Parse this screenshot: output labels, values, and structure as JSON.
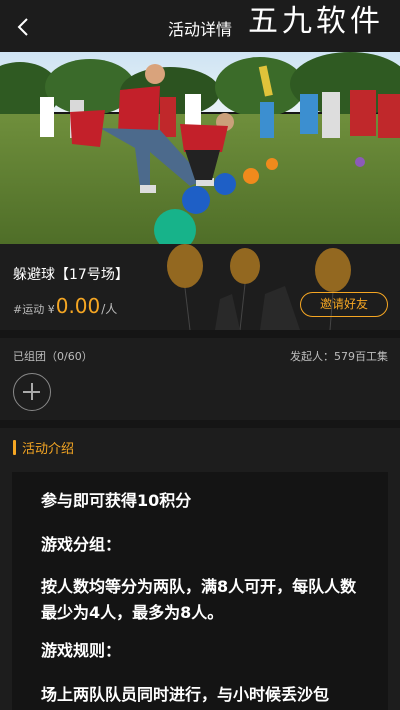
{
  "header": {
    "title": "活动详情",
    "watermark": "五九软件"
  },
  "event": {
    "name": "躲避球【17号场】",
    "price_tag": "#运动 ¥",
    "price": "0.00",
    "price_unit": "/人",
    "invite_label": "邀请好友"
  },
  "groups": {
    "label": "已组团（0/60）",
    "initiator_label": "发起人：",
    "initiator_name": "579百工集"
  },
  "intro": {
    "title": "活动介绍",
    "lines": [
      "参与即可获得10积分",
      "游戏分组：",
      "按人数均等分为两队，满8人可开，每队人数最少为4人，最多为8人。",
      "游戏规则：",
      "场上两队队员同时进行，与小时候丢沙包"
    ]
  },
  "colors": {
    "accent": "#f5a623",
    "background": "#151515",
    "panel": "#1d1d1d"
  }
}
